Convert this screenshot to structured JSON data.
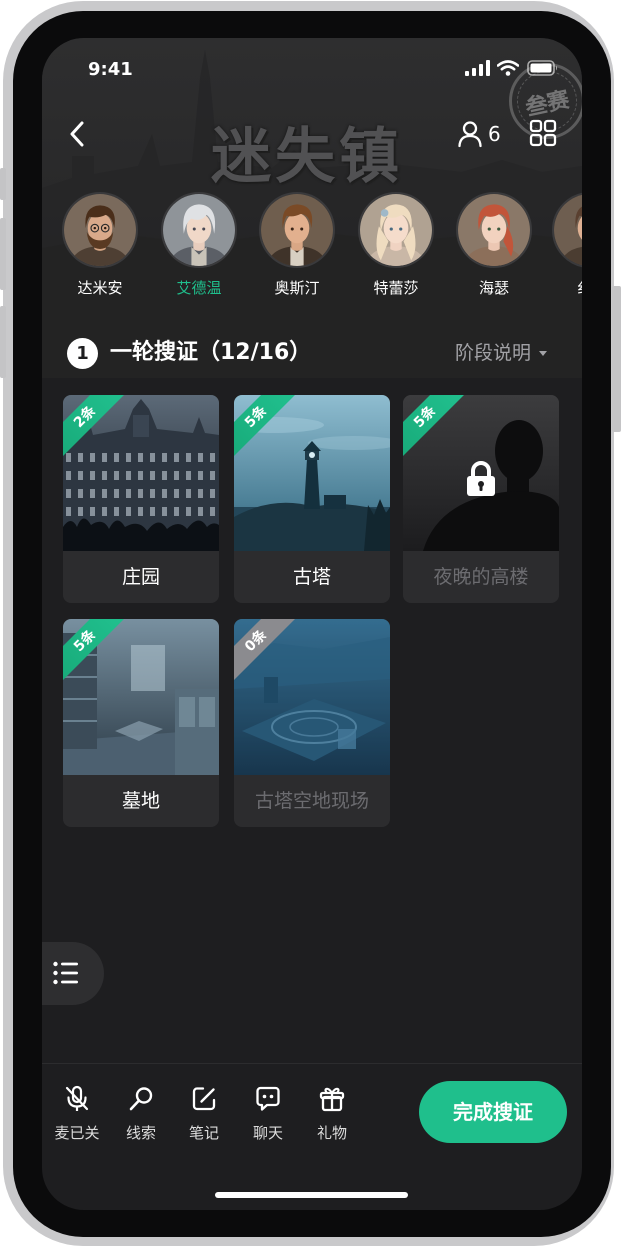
{
  "status_bar": {
    "time": "9:41",
    "icons": [
      "signal-icon",
      "wifi-icon",
      "battery-icon"
    ]
  },
  "header": {
    "back_icon": "chevron-left-icon",
    "title_art": "迷失镇",
    "stamp": "叁赛",
    "players_icon": "person-icon",
    "player_count": "6",
    "menu_icon": "grid-icon"
  },
  "players": [
    {
      "name": "达米安",
      "selected": false
    },
    {
      "name": "艾德温",
      "selected": true
    },
    {
      "name": "奥斯汀",
      "selected": false
    },
    {
      "name": "特蕾莎",
      "selected": false
    },
    {
      "name": "海瑟",
      "selected": false
    },
    {
      "name": "纟",
      "selected": false
    }
  ],
  "round": {
    "number": "1",
    "title": "一轮搜证（12/16）",
    "help_label": "阶段说明",
    "help_icon": "caret-down-icon"
  },
  "scenes": [
    {
      "name": "庄园",
      "clue_count": "2条",
      "locked": false,
      "available": true
    },
    {
      "name": "古塔",
      "clue_count": "5条",
      "locked": false,
      "available": true
    },
    {
      "name": "夜晚的高楼",
      "clue_count": "5条",
      "locked": true,
      "available": false
    },
    {
      "name": "墓地",
      "clue_count": "5条",
      "locked": false,
      "available": true
    },
    {
      "name": "古塔空地现场",
      "clue_count": "0条",
      "locked": false,
      "available": false
    }
  ],
  "floating_menu_icon": "list-icon",
  "toolbar": {
    "items": [
      {
        "label": "麦已关",
        "icon": "mic-off-icon"
      },
      {
        "label": "线索",
        "icon": "magnifier-icon"
      },
      {
        "label": "笔记",
        "icon": "edit-icon"
      },
      {
        "label": "聊天",
        "icon": "chat-icon"
      },
      {
        "label": "礼物",
        "icon": "gift-icon"
      }
    ],
    "finish_label": "完成搜证"
  },
  "colors": {
    "accent": "#1fbf8c",
    "background": "#1e1e20",
    "card": "#2c2c2e",
    "muted_text": "#6c6c70",
    "ribbon_empty": "#8b8b8f"
  }
}
